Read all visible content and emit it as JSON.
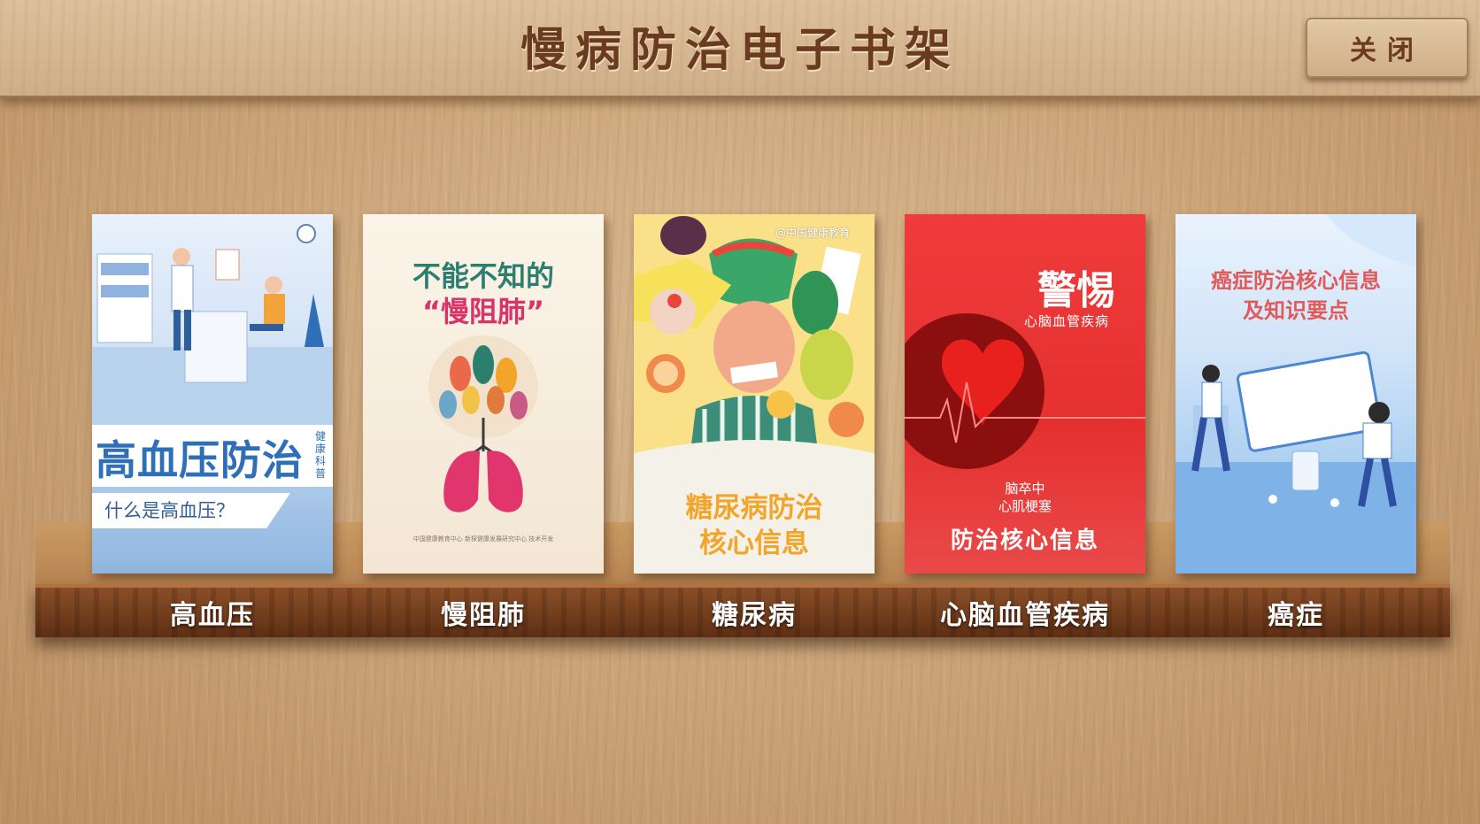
{
  "header": {
    "title": "慢病防治电子书架",
    "close_label": "关闭"
  },
  "books": [
    {
      "shelf_label": "高血压",
      "cover_title": "高血压防治",
      "cover_side_text": "健康科普",
      "cover_tag": "什么是高血压？"
    },
    {
      "shelf_label": "慢阻肺",
      "cover_line1": "不能不知的",
      "cover_line2": "“慢阻肺”",
      "cover_footer": "中国健康教育中心 新探健康发展研究中心 技术开发"
    },
    {
      "shelf_label": "糖尿病",
      "cover_credit": "@中国健康教育",
      "cover_line1": "糖尿病防治",
      "cover_line2": "核心信息"
    },
    {
      "shelf_label": "心脑血管疾病",
      "cover_big": "警惕",
      "cover_sub": "心脑血管疾病",
      "cover_item1": "脑卒中",
      "cover_item2": "心肌梗塞",
      "cover_title": "防治核心信息"
    },
    {
      "shelf_label": "癌症",
      "cover_line1": "癌症防治核心信息",
      "cover_line2": "及知识要点"
    }
  ],
  "colors": {
    "title_brown": "#6b3b1f",
    "shelf_wood": "#6e3a1a",
    "accent_blue": "#2f6fb8",
    "accent_red": "#e53030"
  }
}
